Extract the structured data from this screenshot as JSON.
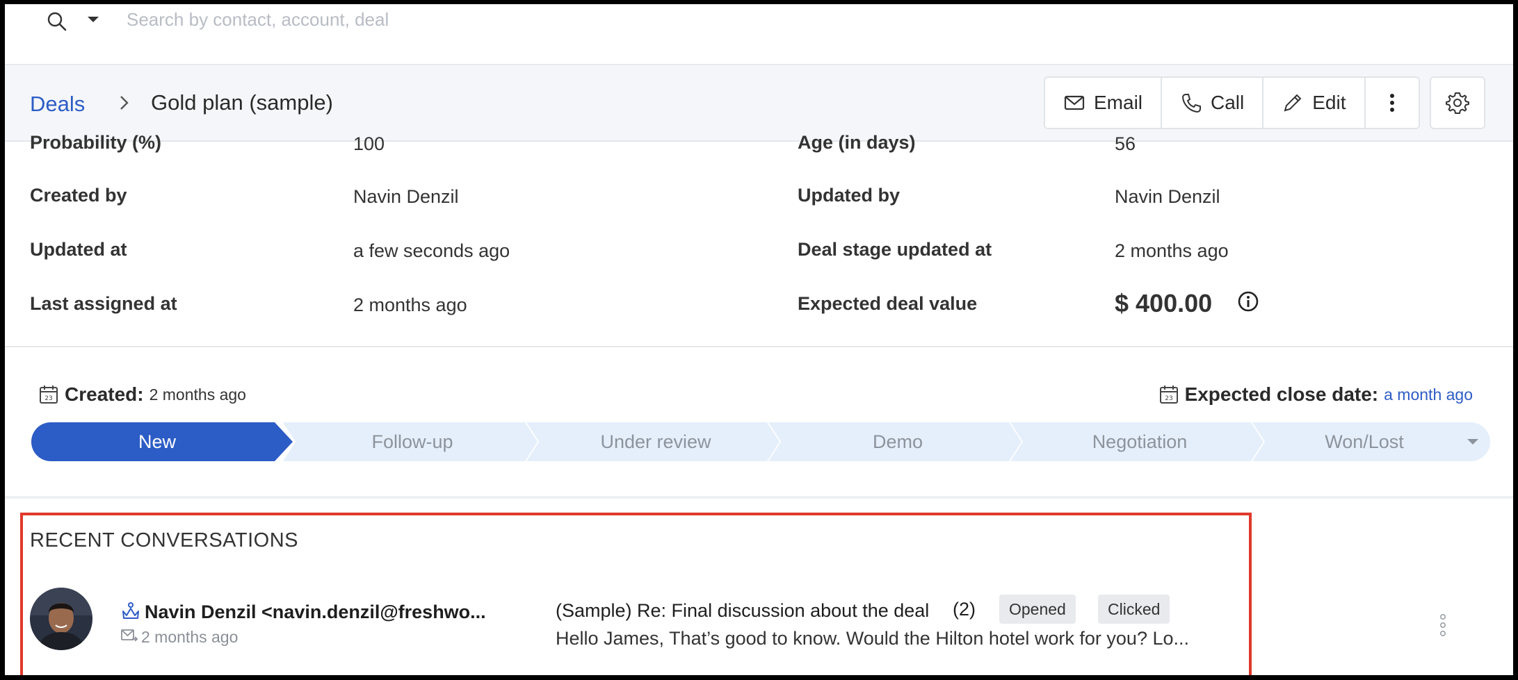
{
  "search": {
    "placeholder": "Search by contact, account, deal"
  },
  "breadcrumb": {
    "root": "Deals",
    "current": "Gold plan (sample)"
  },
  "actions": {
    "email": "Email",
    "call": "Call",
    "edit": "Edit"
  },
  "details": {
    "partial_left_label": "Probability (%)",
    "partial_left_value": "100",
    "partial_right_label": "Age (in days)",
    "partial_right_value": "56",
    "created_by_label": "Created by",
    "created_by_value": "Navin Denzil",
    "updated_by_label": "Updated by",
    "updated_by_value": "Navin Denzil",
    "updated_at_label": "Updated at",
    "updated_at_value": "a few seconds ago",
    "stage_updated_label": "Deal stage updated at",
    "stage_updated_value": "2 months ago",
    "last_assigned_label": "Last assigned at",
    "last_assigned_value": "2 months ago",
    "expected_value_label": "Expected deal value",
    "expected_value_value": "$ 400.00"
  },
  "pipeline": {
    "created_key": "Created:",
    "created_value": "2 months ago",
    "close_key": "Expected close date:",
    "close_value": "a month ago",
    "active_stage": "New",
    "stages": [
      "New",
      "Follow-up",
      "Under review",
      "Demo",
      "Negotiation",
      "Won/Lost"
    ]
  },
  "recent": {
    "title": "RECENT CONVERSATIONS",
    "sender": "Navin Denzil <navin.denzil@freshwo...",
    "sent_time": "2 months ago",
    "subject": "(Sample) Re: Final discussion about the deal",
    "thread_count": "(2)",
    "badge_opened": "Opened",
    "badge_clicked": "Clicked",
    "preview": "Hello James, That’s good to know. Would the Hilton hotel work for you? Lo..."
  },
  "colors": {
    "accent": "#2c5cc5",
    "active_stage": "#2c5cc5",
    "inactive_stage": "#e5effb",
    "highlight_border": "#e0392b"
  }
}
